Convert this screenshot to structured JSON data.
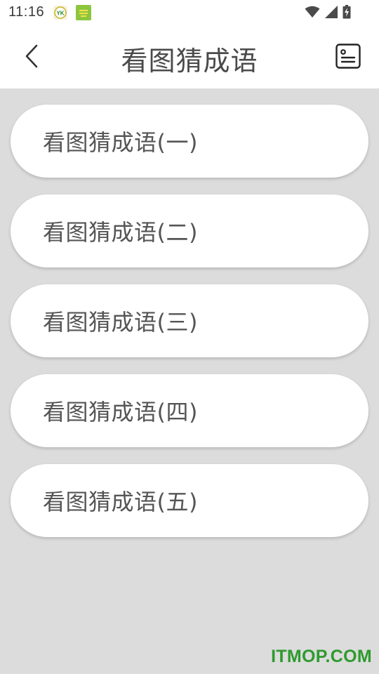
{
  "status_bar": {
    "time": "11:16",
    "notification_badge_text": "YK"
  },
  "header": {
    "title": "看图猜成语"
  },
  "menu": {
    "items": [
      {
        "label": "看图猜成语(一)"
      },
      {
        "label": "看图猜成语(二)"
      },
      {
        "label": "看图猜成语(三)"
      },
      {
        "label": "看图猜成语(四)"
      },
      {
        "label": "看图猜成语(五)"
      }
    ]
  },
  "watermark": {
    "text": "ITMOP.COM"
  },
  "colors": {
    "background": "#dcdcdc",
    "card": "#ffffff",
    "title_text": "#4a4a4a",
    "item_text": "#555555",
    "watermark": "#2e9a2e"
  },
  "icons": {
    "back": "chevron-left-icon",
    "menu": "list-document-icon",
    "wifi": "wifi-icon",
    "signal": "cellular-signal-icon",
    "battery": "battery-charging-icon"
  }
}
